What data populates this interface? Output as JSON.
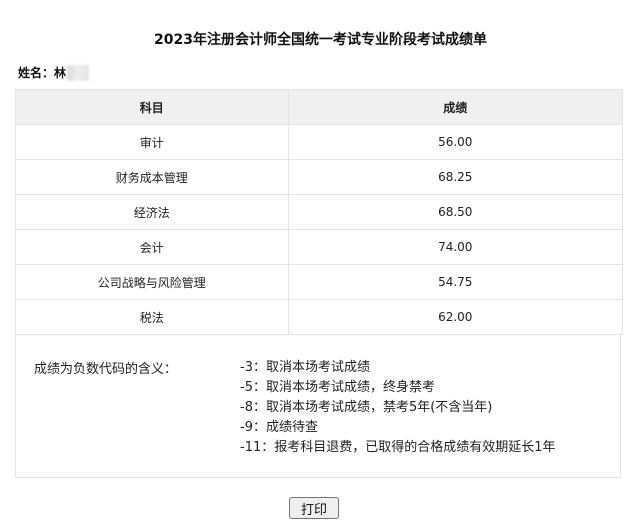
{
  "title": "2023年注册会计师全国统一考试专业阶段考试成绩单",
  "candidate": {
    "label": "姓名：",
    "name": "林"
  },
  "table": {
    "headers": [
      "科目",
      "成绩"
    ],
    "rows": [
      {
        "subject": "审计",
        "score": "56.00"
      },
      {
        "subject": "财务成本管理",
        "score": "68.25"
      },
      {
        "subject": "经济法",
        "score": "68.50"
      },
      {
        "subject": "会计",
        "score": "74.00"
      },
      {
        "subject": "公司战略与风险管理",
        "score": "54.75"
      },
      {
        "subject": "税法",
        "score": "62.00"
      }
    ]
  },
  "notes": {
    "label": "成绩为负数代码的含义：",
    "items": [
      "-3：取消本场考试成绩",
      "-5：取消本场考试成绩，终身禁考",
      "-8：取消本场考试成绩，禁考5年(不含当年)",
      "-9：成绩待查",
      "-11：报考科目退费，已取得的合格成绩有效期延长1年"
    ]
  },
  "print_button": {
    "label": "打印"
  }
}
